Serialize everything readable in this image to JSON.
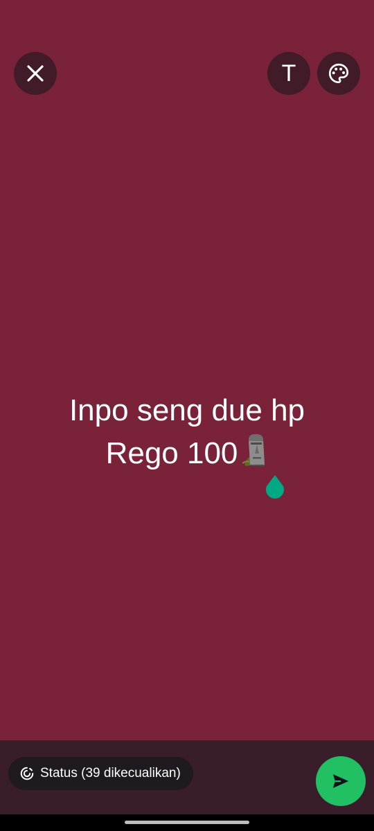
{
  "status_editor": {
    "background_color": "#7a2239",
    "text_lines": [
      "Inpo seng due hp",
      "Rego 100"
    ],
    "text_emoji": "moai-icon"
  },
  "top_toolbar": {
    "close_icon": "close-icon",
    "text_tool_label": "T",
    "palette_icon": "palette-icon"
  },
  "bottom_bar": {
    "audience_label": "Status (39 dikecualikan)",
    "audience_icon": "status-ring-icon",
    "send_icon": "send-icon",
    "send_color": "#21c063"
  }
}
